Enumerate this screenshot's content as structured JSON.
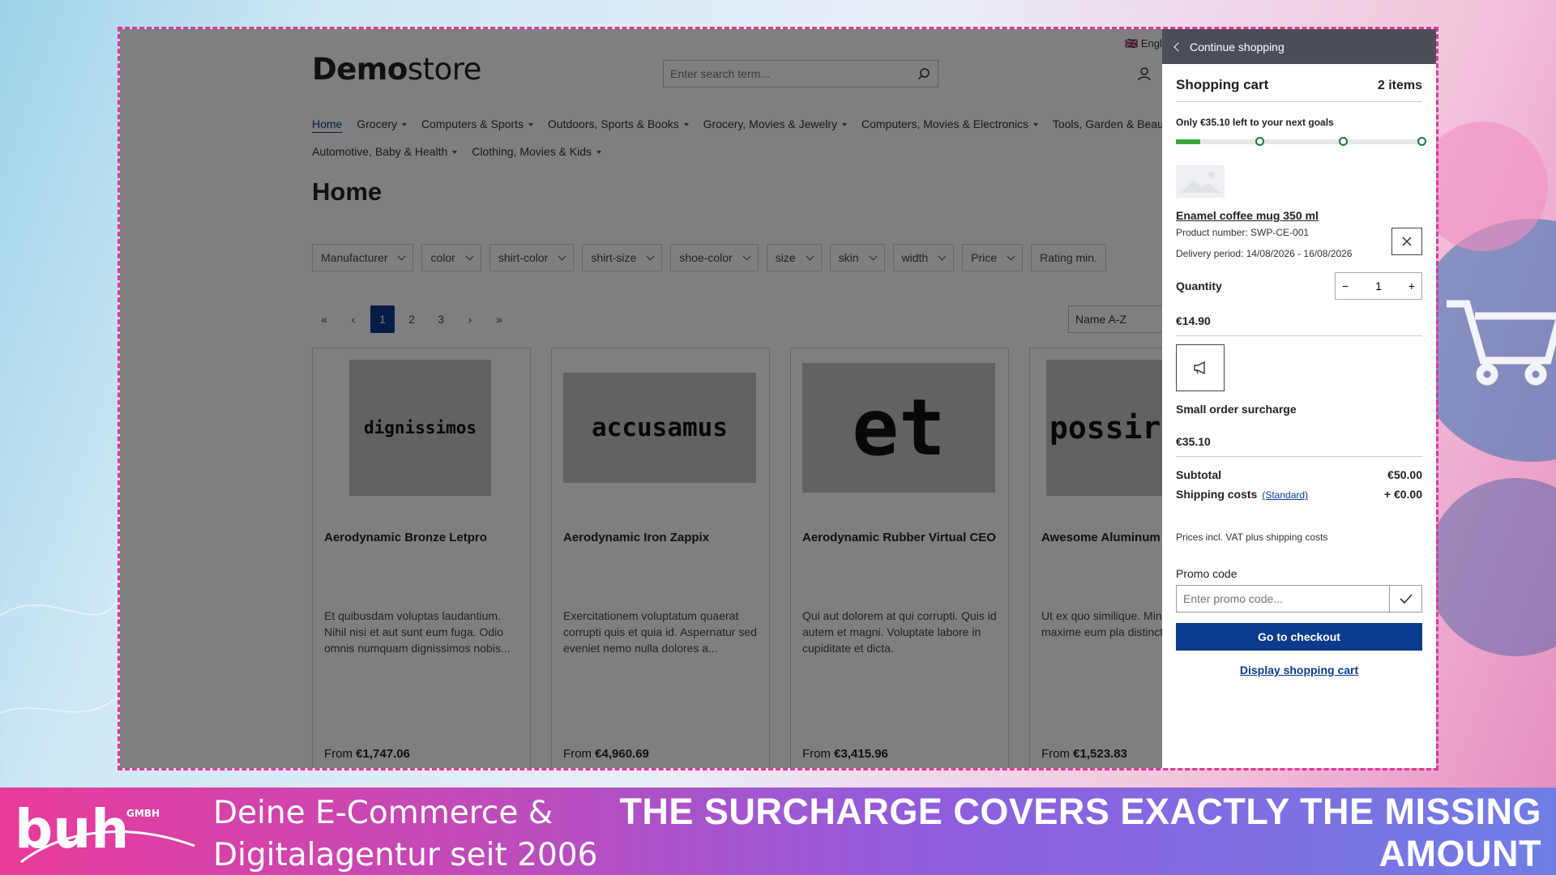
{
  "store": {
    "logo_bold": "Demo",
    "logo_light": "store",
    "language": "Engl",
    "search_placeholder": "Enter search term...",
    "nav": [
      {
        "label": "Home",
        "active": true,
        "dropdown": false
      },
      {
        "label": "Grocery",
        "dropdown": true
      },
      {
        "label": "Computers & Sports",
        "dropdown": true
      },
      {
        "label": "Outdoors, Sports & Books",
        "dropdown": true
      },
      {
        "label": "Grocery, Movies & Jewelry",
        "dropdown": true
      },
      {
        "label": "Computers, Movies & Electronics",
        "dropdown": true
      },
      {
        "label": "Tools, Garden & Beau",
        "dropdown": false
      },
      {
        "label": "Automotive, Baby & Health",
        "dropdown": true
      },
      {
        "label": "Clothing, Movies & Kids",
        "dropdown": true
      }
    ],
    "page_title": "Home",
    "filters": [
      "Manufacturer",
      "color",
      "shirt-color",
      "shirt-size",
      "shoe-color",
      "size",
      "skin",
      "width",
      "Price",
      "Rating min."
    ],
    "pagination": [
      "«",
      "‹",
      "1",
      "2",
      "3",
      "›",
      "»"
    ],
    "current_page": "1",
    "sort_value": "Name A-Z",
    "products": [
      {
        "image_text": "dignissimos",
        "name": "Aerodynamic Bronze Letpro",
        "description": "Et quibusdam voluptas laudantium. Nihil nisi et aut sunt eum fuga. Odio omnis numquam dignissimos nobis...",
        "price_prefix": "From ",
        "price": "€1,747.06"
      },
      {
        "image_text": "accusamus",
        "name": "Aerodynamic Iron Zappix",
        "description": "Exercitationem voluptatum quaerat corrupti quis et quia id. Aspernatur sed eveniet nemo nulla dolores a...",
        "price_prefix": "From ",
        "price": "€4,960.69"
      },
      {
        "image_text": "et",
        "name": "Aerodynamic Rubber Virtual CEO",
        "description": "Qui aut dolorem at qui corrupti. Quis id autem et magni. Voluptate labore in cupiditate et dicta.",
        "price_prefix": "From ",
        "price": "€3,415.96"
      },
      {
        "image_text": "possir",
        "name": "Awesome Aluminum",
        "description": "Ut ex quo similique. Min minima maxime eum pla distinctio.",
        "price_prefix": "From ",
        "price": "€1,523.83"
      }
    ]
  },
  "cart": {
    "continue_label": "Continue shopping",
    "title": "Shopping cart",
    "item_count": "2 items",
    "goal_text": "Only €35.10 left to your next goals",
    "goal_progress": 0.1,
    "item": {
      "name": "Enamel coffee mug 350 ml",
      "product_number": "Product number: SWP-CE-001",
      "delivery": "Delivery period: 14/08/2026 - 16/08/2026",
      "quantity_label": "Quantity",
      "quantity": "1",
      "price": "€14.90"
    },
    "surcharge": {
      "name": "Small order surcharge",
      "price": "€35.10"
    },
    "subtotal_label": "Subtotal",
    "subtotal": "€50.00",
    "shipping_label": "Shipping costs",
    "shipping_method": "(Standard)",
    "shipping": "+ €0.00",
    "vat_note": "Prices incl. VAT plus shipping costs",
    "promo_label": "Promo code",
    "promo_placeholder": "Enter promo code...",
    "checkout_label": "Go to checkout",
    "display_cart_label": "Display shopping cart"
  },
  "banner": {
    "brand": "buh",
    "brand_suffix": "GMBH",
    "tagline_line1": "Deine E-Commerce &",
    "tagline_line2": "Digitalagentur seit 2006",
    "headline": "THE SURCHARGE COVERS EXACTLY THE MISSING AMOUNT"
  },
  "colors": {
    "accent": "#0b3b8c",
    "frame_border": "#e0389a",
    "progress": "#3aa63a"
  }
}
